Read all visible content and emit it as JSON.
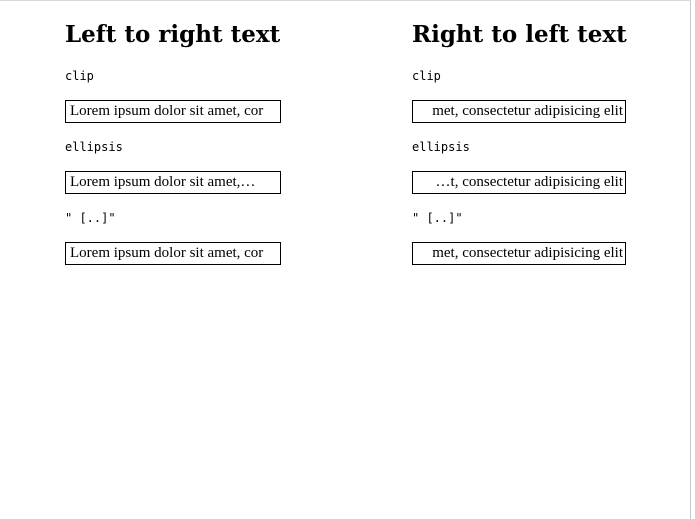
{
  "ltr": {
    "heading": "Left to right text",
    "examples": [
      {
        "label": "clip",
        "text": "Lorem ipsum dolor sit amet, cor"
      },
      {
        "label": "ellipsis",
        "text": "Lorem ipsum dolor sit amet,…"
      },
      {
        "label": "\" [..]\"",
        "text": "Lorem ipsum dolor sit amet, cor"
      }
    ]
  },
  "rtl": {
    "heading": "Right to left text",
    "examples": [
      {
        "label": "clip",
        "text": "met, consectetur adipisicing elit"
      },
      {
        "label": "ellipsis",
        "text": "…t, consectetur adipisicing elit"
      },
      {
        "label": "\" [..]\"",
        "text": "met, consectetur adipisicing elit"
      }
    ]
  }
}
